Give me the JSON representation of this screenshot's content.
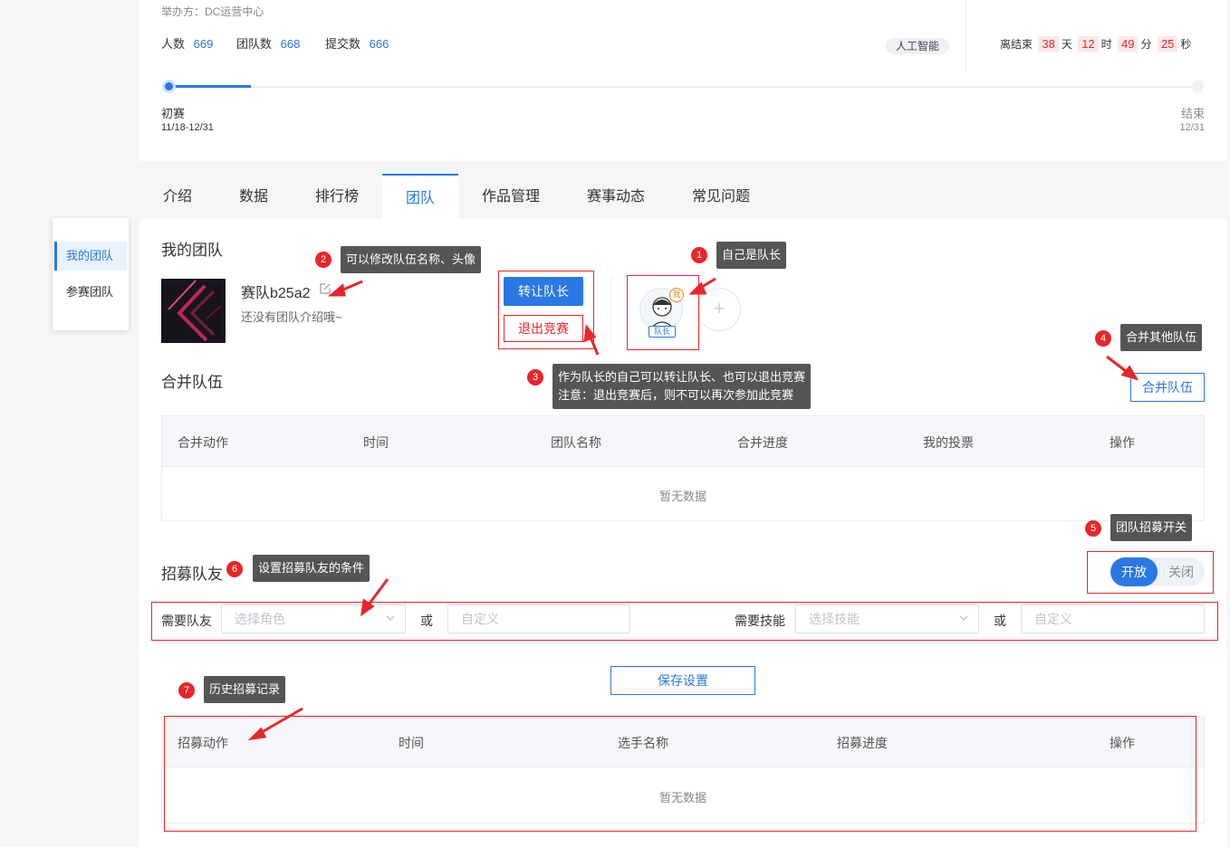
{
  "header": {
    "organizer": "举办方：DC运营中心",
    "stats": [
      {
        "label": "人数",
        "value": "669"
      },
      {
        "label": "团队数",
        "value": "668"
      },
      {
        "label": "提交数",
        "value": "666"
      }
    ],
    "tag": "人工智能",
    "countdown": {
      "prefix": "离结束",
      "days": "38",
      "days_unit": "天",
      "hours": "12",
      "hours_unit": "时",
      "minutes": "49",
      "minutes_unit": "分",
      "seconds": "25",
      "seconds_unit": "秒"
    },
    "timeline": {
      "progress": 0.08,
      "start_stage": "初赛",
      "start_dates": "11/18-12/31",
      "end_stage": "结束",
      "end_date": "12/31"
    }
  },
  "tabs": [
    "介绍",
    "数据",
    "排行榜",
    "团队",
    "作品管理",
    "赛事动态",
    "常见问题"
  ],
  "active_tab": "团队",
  "sidebar": {
    "items": [
      "我的团队",
      "参赛团队"
    ]
  },
  "my_team": {
    "section_title": "我的团队",
    "team_name": "赛队b25a2",
    "team_desc": "还没有团队介绍哦~",
    "transfer_button": "转让队长",
    "quit_button": "退出竞赛",
    "me_badge": "我",
    "captain_badge": "队长",
    "add_symbol": "+"
  },
  "merge": {
    "section_title": "合并队伍",
    "button": "合并队伍",
    "columns": [
      "合并动作",
      "时间",
      "团队名称",
      "合并进度",
      "我的投票",
      "操作"
    ],
    "empty_text": "暂无数据"
  },
  "recruit": {
    "section_title": "招募队友",
    "toggle_on": "开放",
    "toggle_off": "关闭",
    "need_member_label": "需要队友",
    "role_placeholder": "选择角色",
    "or1": "或",
    "custom_placeholder1": "自定义",
    "need_skill_label": "需要技能",
    "skill_placeholder": "选择技能",
    "or2": "或",
    "custom_placeholder2": "自定义",
    "save_button": "保存设置"
  },
  "history": {
    "columns": [
      "招募动作",
      "时间",
      "选手名称",
      "招募进度",
      "操作"
    ],
    "empty_text": "暂无数据"
  },
  "annotations": [
    {
      "num": "1",
      "text": "自己是队长"
    },
    {
      "num": "2",
      "text": "可以修改队伍名称、头像"
    },
    {
      "num": "3",
      "text_line1": "作为队长的自己可以转让队长、也可以退出竞赛",
      "text_line2": "注意：退出竞赛后，则不可以再次参加此竞赛"
    },
    {
      "num": "4",
      "text": "合并其他队伍"
    },
    {
      "num": "5",
      "text": "团队招募开关"
    },
    {
      "num": "6",
      "text": "设置招募队友的条件"
    },
    {
      "num": "7",
      "text": "历史招募记录"
    }
  ],
  "colors": {
    "accent": "#2a78e4",
    "annotation": "#e8262a",
    "tooltip": "#555555"
  }
}
